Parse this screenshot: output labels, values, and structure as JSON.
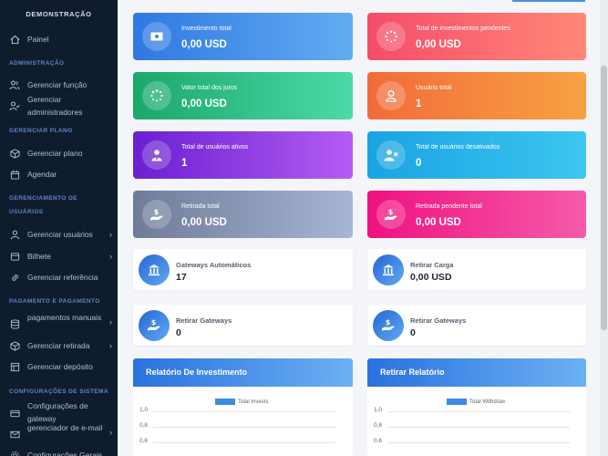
{
  "sidebar": {
    "brand": "DEMONSTRAÇÃO",
    "sections": {
      "admin": "ADMINISTRAÇÃO",
      "plan": "GERENCIAR PLANO",
      "users_mgmt": "GERENCIAMENTO DE USUÁRIOS",
      "payment": "PAGAMENTO E PAGAMENTO",
      "system": "CONFIGURAÇÕES DE SISTEMA"
    },
    "items": {
      "panel": "Painel",
      "manage_role": "Gerenciar função",
      "manage_admins": "Gerenciar administradores",
      "manage_plan": "Gerenciar plano",
      "schedule": "Agendar",
      "manage_users": "Gerenciar usuários",
      "ticket": "Bilhete",
      "manage_referral": "Gerenciar referência",
      "manual_payments": "pagamentos manuais",
      "manage_withdrawal": "Gerenciar retirada",
      "manage_deposit": "Gerenciar depósito",
      "gateway_settings": "Configurações de gateway",
      "email_manager": "gerenciador de e-mail",
      "general_settings": "Configurações Gerais"
    }
  },
  "stats": {
    "total_investment": {
      "title": "Investimento total",
      "value": "0,00 USD"
    },
    "pending_investments": {
      "title": "Total de investimentos pendentes",
      "value": "0,00 USD"
    },
    "total_interest": {
      "title": "Valor total dos juros",
      "value": "0,00 USD"
    },
    "total_users": {
      "title": "Usuário total",
      "value": "1"
    },
    "active_users": {
      "title": "Total de usuários ativos",
      "value": "1"
    },
    "disabled_users": {
      "title": "Total de usuários desativados",
      "value": "0"
    },
    "total_withdrawal": {
      "title": "Retirada total",
      "value": "0,00 USD"
    },
    "pending_withdrawal": {
      "title": "Retirada pendente total",
      "value": "0,00 USD"
    }
  },
  "widgets": {
    "auto_gateways": {
      "title": "Gateways Automáticos",
      "value": "17"
    },
    "withdraw_charge": {
      "title": "Retirar Carga",
      "value": "0,00 USD"
    },
    "withdraw_gateways_1": {
      "title": "Retirar Gateways",
      "value": "0"
    },
    "withdraw_gateways_2": {
      "title": "Retirar Gateways",
      "value": "0"
    }
  },
  "reports": {
    "investment": {
      "title": "Relatório De Investimento",
      "legend": "Total Invests",
      "yticks": [
        "1,0",
        "0,8",
        "0,6"
      ]
    },
    "withdraw": {
      "title": "Retirar Relatório",
      "legend": "Total Withdraw",
      "yticks": [
        "1,0",
        "0,8",
        "0,6"
      ]
    }
  },
  "colors": {
    "sidebar": "#0f1c2d",
    "accent": "#2f78e2",
    "section": "#5d86c7"
  }
}
